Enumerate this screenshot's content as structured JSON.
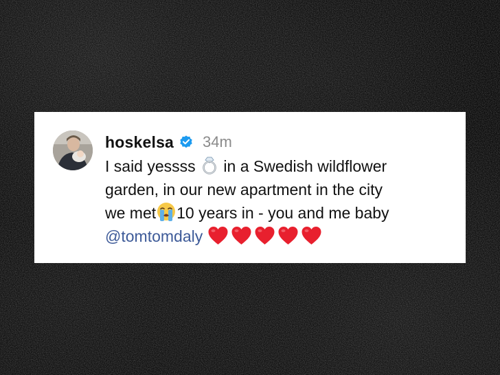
{
  "post": {
    "username": "hoskelsa",
    "timestamp": "34m",
    "caption": {
      "line1_before": "I said yessss ",
      "line1_after": " in a Swedish wildflower",
      "line2": "garden, in our new apartment in the city",
      "line3_before": "we met",
      "line3_after": "10 years in - you and me baby",
      "mention": "@tomtomdaly"
    },
    "icons": [
      "verified-badge-icon",
      "ring-emoji-icon",
      "crying-face-emoji-icon",
      "red-heart-emoji-icon"
    ],
    "heart_count": 5,
    "colors": {
      "verified": "#1d9bf0",
      "mention": "#3d5a98",
      "heart": "#e8202e",
      "timestamp": "#8a8a8a"
    }
  }
}
